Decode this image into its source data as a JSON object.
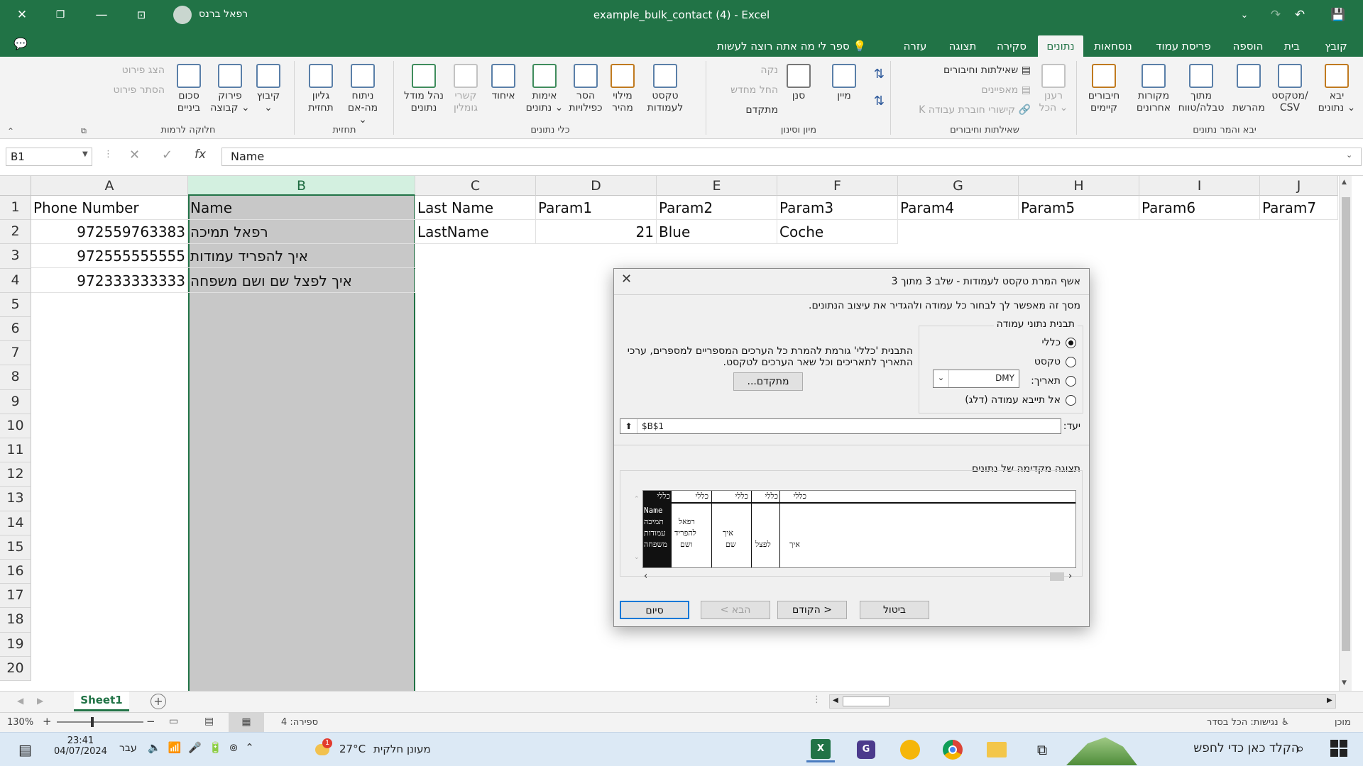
{
  "window": {
    "title": "example_bulk_contact (4)  -  Excel",
    "user": "רפאל ברנס",
    "colors": {
      "brand": "#217346",
      "selection": "#c8c8c8"
    }
  },
  "tabs": [
    {
      "label": "קובץ"
    },
    {
      "label": "בית"
    },
    {
      "label": "הוספה"
    },
    {
      "label": "פריסת עמוד"
    },
    {
      "label": "נוסחאות"
    },
    {
      "label": "נתונים"
    },
    {
      "label": "סקירה"
    },
    {
      "label": "תצוגה"
    },
    {
      "label": "עזרה"
    }
  ],
  "tell_me": "ספר לי מה אתה רוצה לעשות",
  "ribbon": {
    "get_data": {
      "group": "יבא והמר נתונים",
      "items": [
        {
          "label1": "יבא",
          "label2": "נתונים ⌄"
        },
        {
          "label1": "מטקסט/",
          "label2": "CSV"
        },
        {
          "label1": "",
          "label2": "מהרשת"
        },
        {
          "label1": "מתוך",
          "label2": "טבלה/טווח"
        },
        {
          "label1": "מקורות",
          "label2": "אחרונים"
        },
        {
          "label1": "חיבורים",
          "label2": "קיימים"
        }
      ]
    },
    "queries": {
      "group": "שאילתות וחיבורים",
      "refresh1": "רענן",
      "refresh2": "הכל ⌄",
      "queries": "שאילתות וחיבורים",
      "props": "מאפיינים",
      "links": "קישורי חוברת עבודה K"
    },
    "sort": {
      "group": "מיון וסינון",
      "sort": "מיין",
      "filter": "סנן",
      "clear": "נקה",
      "reapply": "החל מחדש",
      "advanced": "מתקדם"
    },
    "tools": {
      "group": "כלי נתונים",
      "items": [
        {
          "label1": "טקסט",
          "label2": "לעמודות"
        },
        {
          "label1": "מילוי",
          "label2": "מהיר"
        },
        {
          "label1": "הסר",
          "label2": "כפילויות"
        },
        {
          "label1": "אימות",
          "label2": "נתונים ⌄"
        },
        {
          "label1": "איחוד",
          "label2": ""
        },
        {
          "label1": "קשרי",
          "label2": "גומלין"
        },
        {
          "label1": "נהל מודל",
          "label2": "נתונים"
        }
      ]
    },
    "forecast": {
      "group": "תחזית",
      "items": [
        {
          "label1": "ניתוח",
          "label2": "מה-אם ⌄"
        },
        {
          "label1": "גליון",
          "label2": "תחזית"
        }
      ]
    },
    "outline": {
      "group": "חלוקה לרמות",
      "items": [
        {
          "label1": "קיבוץ",
          "label2": "⌄"
        },
        {
          "label1": "פירוק",
          "label2": "קבוצה ⌄"
        },
        {
          "label1": "סכום",
          "label2": "ביניים"
        }
      ],
      "show": "הצג פירוט",
      "hide": "הסתר פירוט"
    }
  },
  "formula_bar": {
    "name_box": "B1",
    "value": "Name"
  },
  "columns": [
    "A",
    "B",
    "C",
    "D",
    "E",
    "F",
    "G",
    "H",
    "I",
    "J"
  ],
  "rows": [
    "1",
    "2",
    "3",
    "4",
    "5",
    "6",
    "7",
    "8",
    "9",
    "10",
    "11",
    "12",
    "13",
    "14",
    "15",
    "16",
    "17",
    "18",
    "19",
    "20"
  ],
  "cells": {
    "r1": [
      "Phone Number",
      "Name",
      "Last Name",
      "Param1",
      "Param2",
      "Param3",
      "Param4",
      "Param5",
      "Param6",
      "Param7"
    ],
    "r2": {
      "a": "972559763383",
      "b": "רפאל תמיכה",
      "c": "LastName",
      "d": "21",
      "e": "Blue",
      "f": "Coche"
    },
    "r3": {
      "a": "972555555555",
      "b": "איך להפריד עמודות"
    },
    "r4": {
      "a": "972333333333",
      "b": "איך לפצל שם ושם משפחה"
    }
  },
  "sheet_tab": "Sheet1",
  "status": {
    "ready": "מוכן",
    "accessibility": "נגישות: הכל בסדר",
    "count": "ספירה: 4",
    "zoom": "130%"
  },
  "dialog": {
    "title": "אשף המרת טקסט לעמודות - שלב 3 מתוך 3",
    "desc": "מסך זה מאפשר לך לבחור כל עמודה ולהגדיר את עיצוב הנתונים.",
    "format_label": "תבנית נתוני עמודה",
    "opt_general": "כללי",
    "opt_text": "טקסט",
    "opt_date": "תאריך:",
    "date_value": "DMY",
    "opt_skip": "אל תייבא עמודה (דלג)",
    "info1": "התבנית 'כללי' גורמת להמרת כל הערכים המספריים למספרים, ערכי",
    "info2": "התאריך לתאריכים וכל שאר הערכים לטקסט.",
    "advanced_btn": "מתקדם...",
    "dest_label": "יעד:",
    "dest_value": "$B$1",
    "preview_label": "תצוגה מקדימה של נתונים",
    "preview_headers": [
      "כללי",
      "כללי",
      "כללי",
      "כללי",
      "כללי"
    ],
    "preview_col1": [
      "Name",
      "תמיכה",
      "עמודות",
      "משפחה"
    ],
    "preview_col2": [
      "רפאל",
      "להפריד",
      "ושם"
    ],
    "preview_col3": [
      "איך",
      "שם"
    ],
    "preview_col4": [
      "לפצל"
    ],
    "preview_col5": [
      "איך"
    ],
    "cancel": "ביטול",
    "back": "< הקודם",
    "next": "הבא >",
    "finish": "סיום"
  },
  "taskbar": {
    "time": "23:41",
    "date": "04/07/2024",
    "lang": "עבר",
    "temp": "27°C",
    "weather": "מעונן חלקית",
    "search": "הקלד כאן כדי לחפש",
    "badge": "1"
  }
}
